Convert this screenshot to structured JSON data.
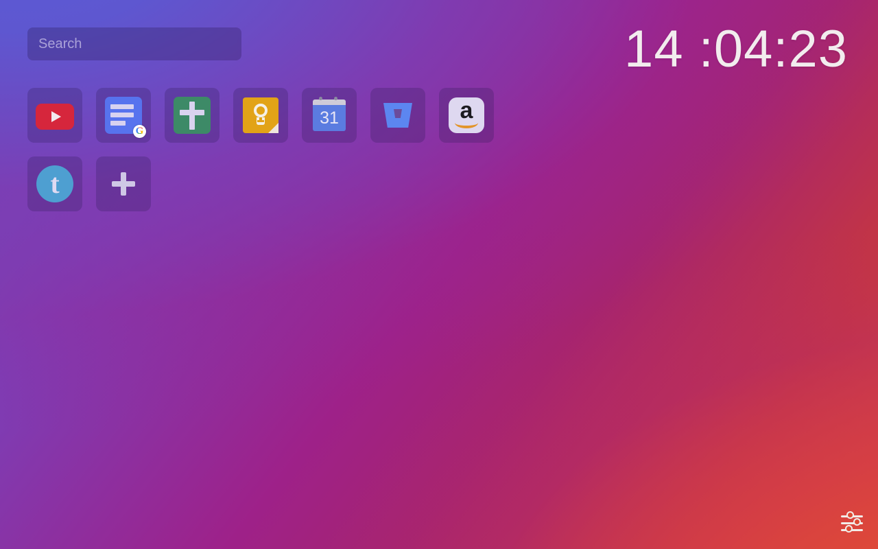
{
  "page": {
    "title": "New Tab",
    "background": {
      "from": "#5a59d3",
      "mid": "#9e2189",
      "to": "#e04a33"
    }
  },
  "search": {
    "name": "search-input",
    "placeholder": "Search",
    "value": ""
  },
  "clock": {
    "time": "14 :04:23",
    "hours": "14",
    "minutes": "04",
    "seconds": "23",
    "color": "#f2ecee"
  },
  "apps": [
    {
      "label": "YouTube",
      "icon": "youtube-icon",
      "color": "#d6263c"
    },
    {
      "label": "Google Docs",
      "icon": "google-docs-icon",
      "color": "#5773ee"
    },
    {
      "label": "Cross",
      "icon": "green-cross-icon",
      "color": "#3d8a67"
    },
    {
      "label": "Google Keep",
      "icon": "google-keep-icon",
      "color": "#e2a317"
    },
    {
      "label": "Google Calendar",
      "icon": "google-calendar-icon",
      "color": "#5b7ce0",
      "day": "31"
    },
    {
      "label": "Bitbucket",
      "icon": "bitbucket-icon",
      "color": "#5c86f0"
    },
    {
      "label": "Amazon",
      "icon": "amazon-icon",
      "color": "#ded8f0"
    },
    {
      "label": "Tumblr",
      "icon": "tumblr-icon",
      "color": "#4e9fd1",
      "letter": "t"
    },
    {
      "label": "Add shortcut",
      "icon": "plus-icon",
      "color": "#cfc7e6"
    }
  ],
  "google_badge": {
    "letter": "G"
  },
  "settings": {
    "label": "Settings",
    "icon": "sliders-icon"
  }
}
